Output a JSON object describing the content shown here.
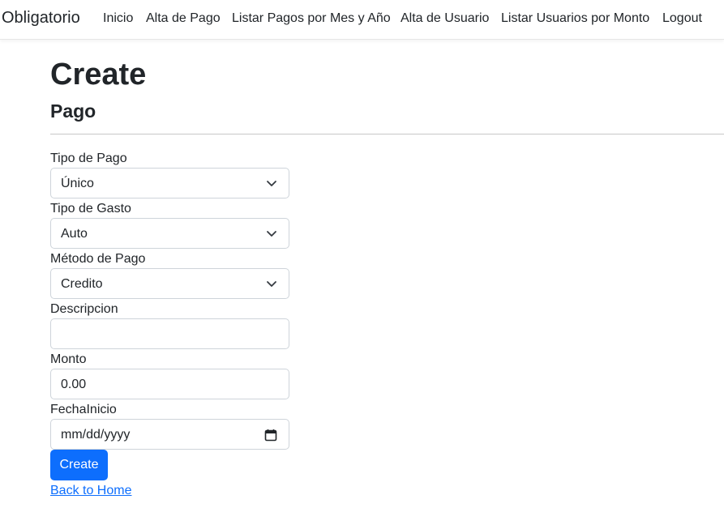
{
  "navbar": {
    "brand": "Obligatorio",
    "links": [
      "Inicio",
      "Alta de Pago",
      "Listar Pagos por Mes y Año",
      "Alta de Usuario",
      "Listar Usuarios por Monto",
      "Logout"
    ]
  },
  "page": {
    "title": "Create",
    "subtitle": "Pago"
  },
  "form": {
    "tipo_pago": {
      "label": "Tipo de Pago",
      "value": "Único"
    },
    "tipo_gasto": {
      "label": "Tipo de Gasto",
      "value": "Auto"
    },
    "metodo_pago": {
      "label": "Método de Pago",
      "value": "Credito"
    },
    "descripcion": {
      "label": "Descripcion",
      "value": ""
    },
    "monto": {
      "label": "Monto",
      "value": "0.00"
    },
    "fecha_inicio": {
      "label": "FechaInicio",
      "value": "mm/dd/yyyy"
    },
    "submit_label": "Create"
  },
  "back_link": "Back to Home",
  "colors": {
    "primary": "#0d6efd",
    "text": "#212529",
    "border": "#ced4da"
  },
  "icons": {
    "select_arrow": "chevron-down-icon",
    "date_picker": "calendar-icon"
  }
}
